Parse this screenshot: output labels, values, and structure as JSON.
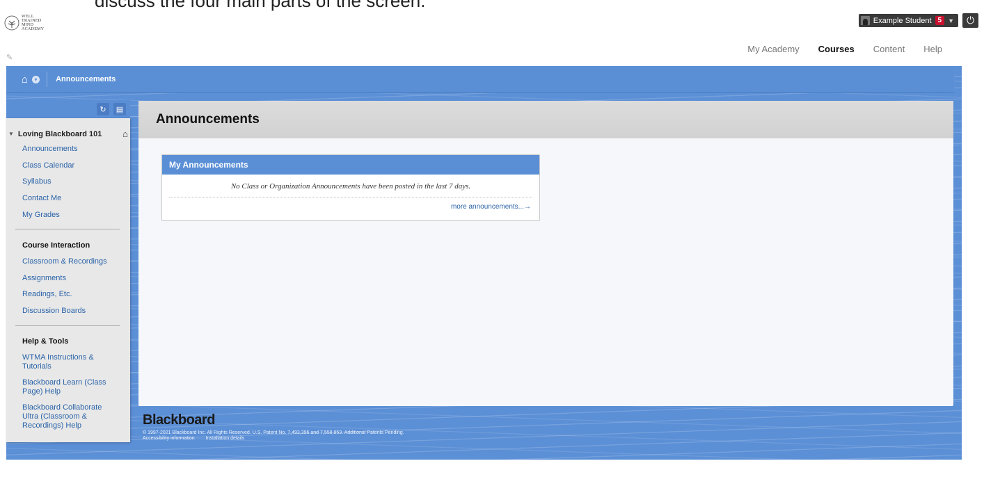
{
  "slide_caption": "discuss the four main parts of the screen.",
  "logo": {
    "text_lines": [
      "WELL",
      "TRAINED",
      "MIND",
      "ACADEMY"
    ]
  },
  "user": {
    "name": "Example Student",
    "notification_count": "5"
  },
  "top_nav": [
    {
      "label": "My Academy"
    },
    {
      "label": "Courses",
      "active": true
    },
    {
      "label": "Content"
    },
    {
      "label": "Help"
    }
  ],
  "breadcrumb": {
    "current": "Announcements"
  },
  "sidebar": {
    "course_title": "Loving Blackboard 101",
    "links_1": [
      "Announcements",
      "Class Calendar",
      "Syllabus",
      "Contact Me",
      "My Grades"
    ],
    "section_2_title": "Course Interaction",
    "links_2": [
      "Classroom & Recordings",
      "Assignments",
      "Readings, Etc.",
      "Discussion Boards"
    ],
    "section_3_title": "Help & Tools",
    "links_3": [
      "WTMA Instructions & Tutorials",
      "Blackboard Learn (Class Page) Help",
      "Blackboard Collaborate Ultra (Classroom & Recordings) Help"
    ]
  },
  "main": {
    "page_title": "Announcements",
    "module_title": "My Announcements",
    "empty_message": "No Class or Organization Announcements have been posted in the last 7 days.",
    "more_link": "more announcements...→"
  },
  "footer": {
    "brand": "Blackboard",
    "copyright": "© 1997-2021 Blackboard Inc. All Rights Reserved. U.S. Patent No. 7,493,396 and 7,558,853. Additional Patents Pending.",
    "link_accessibility": "Accessibility information",
    "link_installation": "Installation details"
  },
  "colors": {
    "accent_blue": "#5a8fd6",
    "link_blue": "#2a63a8",
    "badge_red": "#c8102e"
  }
}
